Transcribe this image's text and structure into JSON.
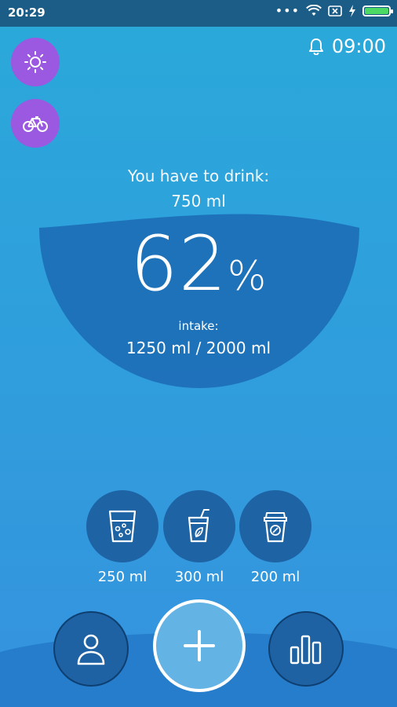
{
  "status": {
    "time": "20:29",
    "dots": "•••"
  },
  "alarm": {
    "time": "09:00"
  },
  "goal": {
    "to_drink_label": "You have to drink:",
    "to_drink_value": "750 ml",
    "percent_value": "62",
    "percent_sign": "%",
    "intake_label": "intake:",
    "intake_value": "1250 ml / 2000 ml"
  },
  "progress": {
    "fraction": 0.62
  },
  "drinks": [
    {
      "label": "250 ml",
      "icon": "water-glass-icon"
    },
    {
      "label": "300 ml",
      "icon": "juice-cup-icon"
    },
    {
      "label": "200 ml",
      "icon": "coffee-cup-icon"
    }
  ],
  "modes": [
    {
      "icon": "sun-icon"
    },
    {
      "icon": "bike-icon"
    }
  ],
  "colors": {
    "mode_button": "#9b58e0",
    "accent_dark": "#1e63a4",
    "status_bar": "#1b5d86",
    "battery": "#4cd964"
  }
}
